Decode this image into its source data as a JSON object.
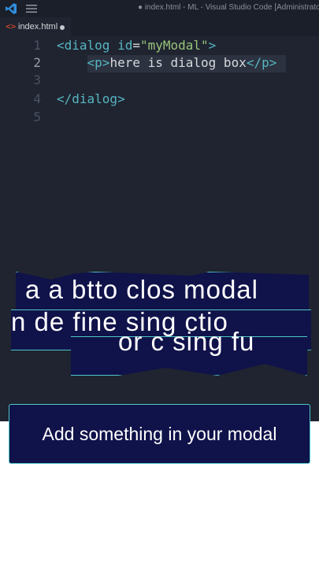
{
  "window": {
    "title": "● index.html - ML - Visual Studio Code [Administrator]"
  },
  "tab": {
    "name": "index.html",
    "icon": "html-file-icon",
    "modified": true
  },
  "editor": {
    "lines": [
      {
        "num": "1",
        "parts": [
          [
            "tag",
            "<dialog "
          ],
          [
            "attr",
            "id"
          ],
          [
            "plain",
            "="
          ],
          [
            "str",
            "\"myModal\""
          ],
          [
            "tag",
            ">"
          ]
        ]
      },
      {
        "num": "2",
        "parts": [
          [
            "plain",
            "    "
          ],
          [
            "tag",
            "<p>"
          ],
          [
            "plain",
            "here is dialog box"
          ],
          [
            "tag",
            "</p>"
          ]
        ]
      },
      {
        "num": "3",
        "parts": []
      },
      {
        "num": "4",
        "parts": [
          [
            "tag",
            "</dialog>"
          ]
        ]
      },
      {
        "num": "5",
        "parts": []
      }
    ]
  },
  "overlay": {
    "glitch_lines": [
      "a a btto  clos  modal",
      "n  de  fine  sing  ctio",
      "or  c  sing  fu"
    ]
  },
  "caption": {
    "text": "Add something in your modal"
  },
  "colors": {
    "editor_bg": "#1f2430",
    "caption_bg": "#10124a",
    "caption_border": "#4fc7c9",
    "tag": "#56b6c2",
    "string": "#98c379"
  }
}
